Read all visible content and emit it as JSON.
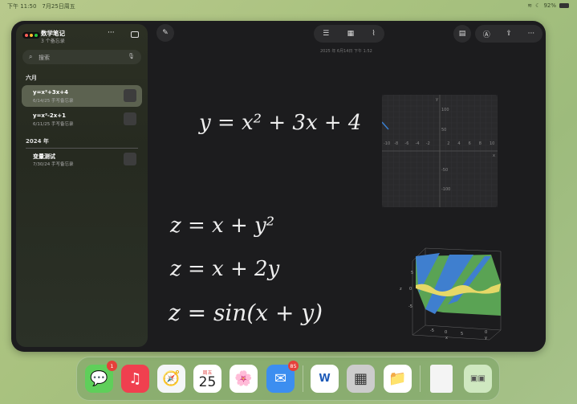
{
  "status": {
    "time": "下午 11:50",
    "date": "7月25日周五",
    "battery": "92%"
  },
  "sidebar": {
    "title": "数学笔记",
    "subtitle": "3 个备忘录",
    "search_placeholder": "搜索",
    "sections": [
      {
        "label": "六月"
      },
      {
        "label": "2024 年"
      }
    ],
    "items": [
      {
        "title": "y=x²+3x+4",
        "meta": "6/14/25  手写备忘录",
        "selected": true
      },
      {
        "title": "y=x²-2x+1",
        "meta": "6/11/25  手写备忘录"
      },
      {
        "title": "变量测试",
        "meta": "7/30/24  手写备忘录"
      }
    ]
  },
  "note": {
    "date": "2025 年 6月14日 下午 1:52",
    "equations": [
      "y = x² + 3x + 4",
      "z = x + y²",
      "z = x + 2y",
      "z = sin(x + y)"
    ]
  },
  "graph": {
    "x_ticks": [
      "-10",
      "-8",
      "-6",
      "-4",
      "-2",
      "2",
      "4",
      "6",
      "8",
      "10"
    ],
    "y_ticks": [
      "100",
      "50",
      "-50",
      "-100"
    ],
    "x_label": "x",
    "y_label": "y"
  },
  "plot3d": {
    "z_label": "z",
    "x_label": "x",
    "y_label": "y",
    "z_ticks": [
      "5",
      "0",
      "-5"
    ],
    "x_ticks": [
      "-5",
      "0",
      "5"
    ],
    "y_ticks": [
      "0"
    ]
  },
  "dock": {
    "apps": [
      {
        "name": "Messages",
        "badge": "1"
      },
      {
        "name": "Music"
      },
      {
        "name": "Safari"
      },
      {
        "name": "Calendar",
        "day": "周五",
        "date": "25"
      },
      {
        "name": "Photos"
      },
      {
        "name": "Mail",
        "badge": "85"
      },
      {
        "name": "Word"
      },
      {
        "name": "Calculator"
      },
      {
        "name": "Files"
      },
      {
        "name": "Document"
      },
      {
        "name": "App Library"
      }
    ]
  }
}
